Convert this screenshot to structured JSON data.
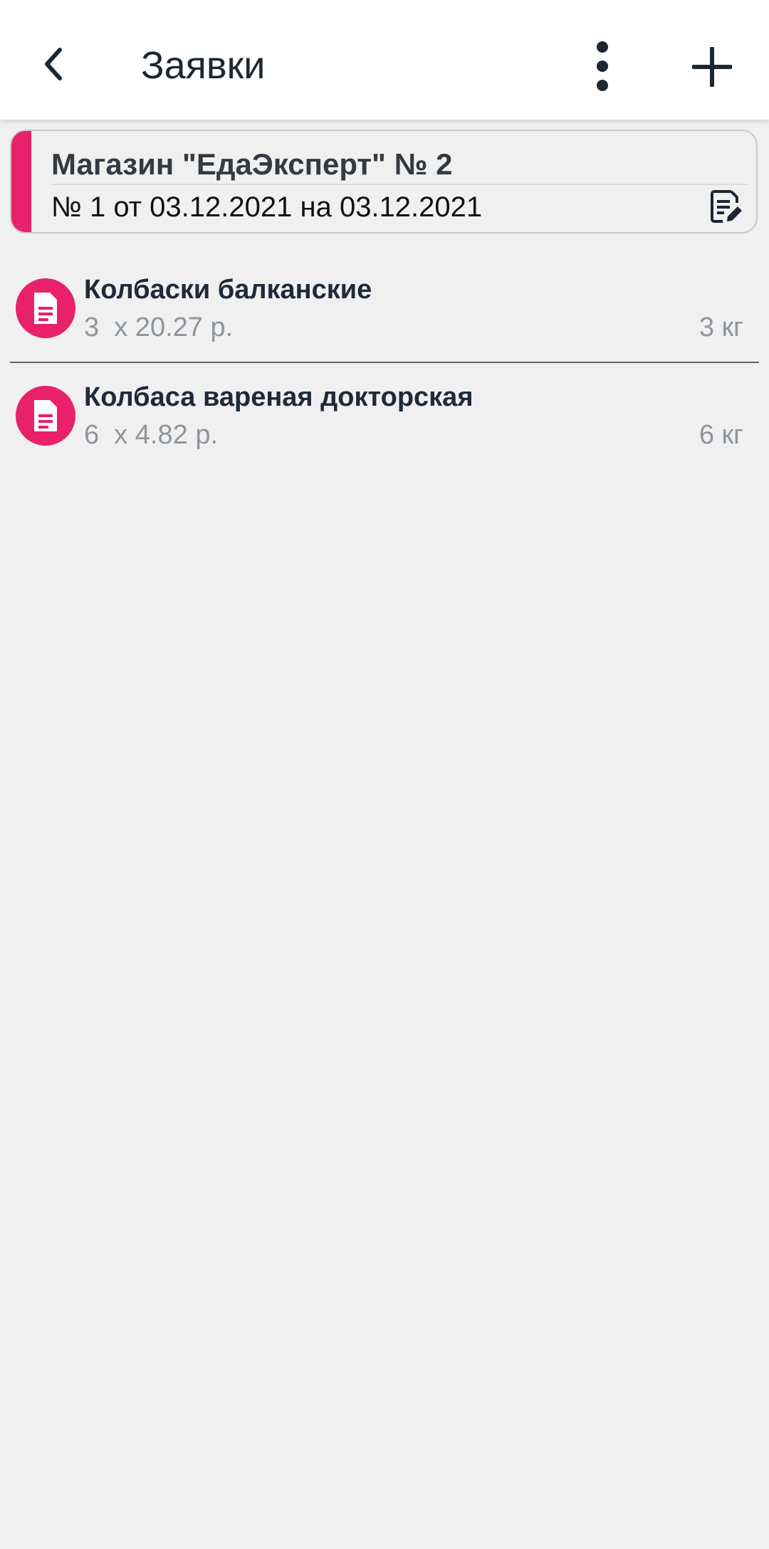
{
  "appbar": {
    "title": "Заявки",
    "back_icon": "chevron-left-icon",
    "more_icon": "more-vertical-icon",
    "add_icon": "plus-icon"
  },
  "order": {
    "title": "Магазин \"ЕдаЭксперт\" № 2",
    "subtitle": "№ 1 от 03.12.2021 на 03.12.2021",
    "edit_icon": "document-edit-icon",
    "accent_color": "#e8216a"
  },
  "items": [
    {
      "name": "Колбаски балканские",
      "quantity": "3  х 20.27 р.",
      "weight": "3 кг",
      "icon": "document-icon"
    },
    {
      "name": "Колбаса вареная докторская",
      "quantity": "6  х 4.82 р.",
      "weight": "6 кг",
      "icon": "document-icon"
    }
  ]
}
